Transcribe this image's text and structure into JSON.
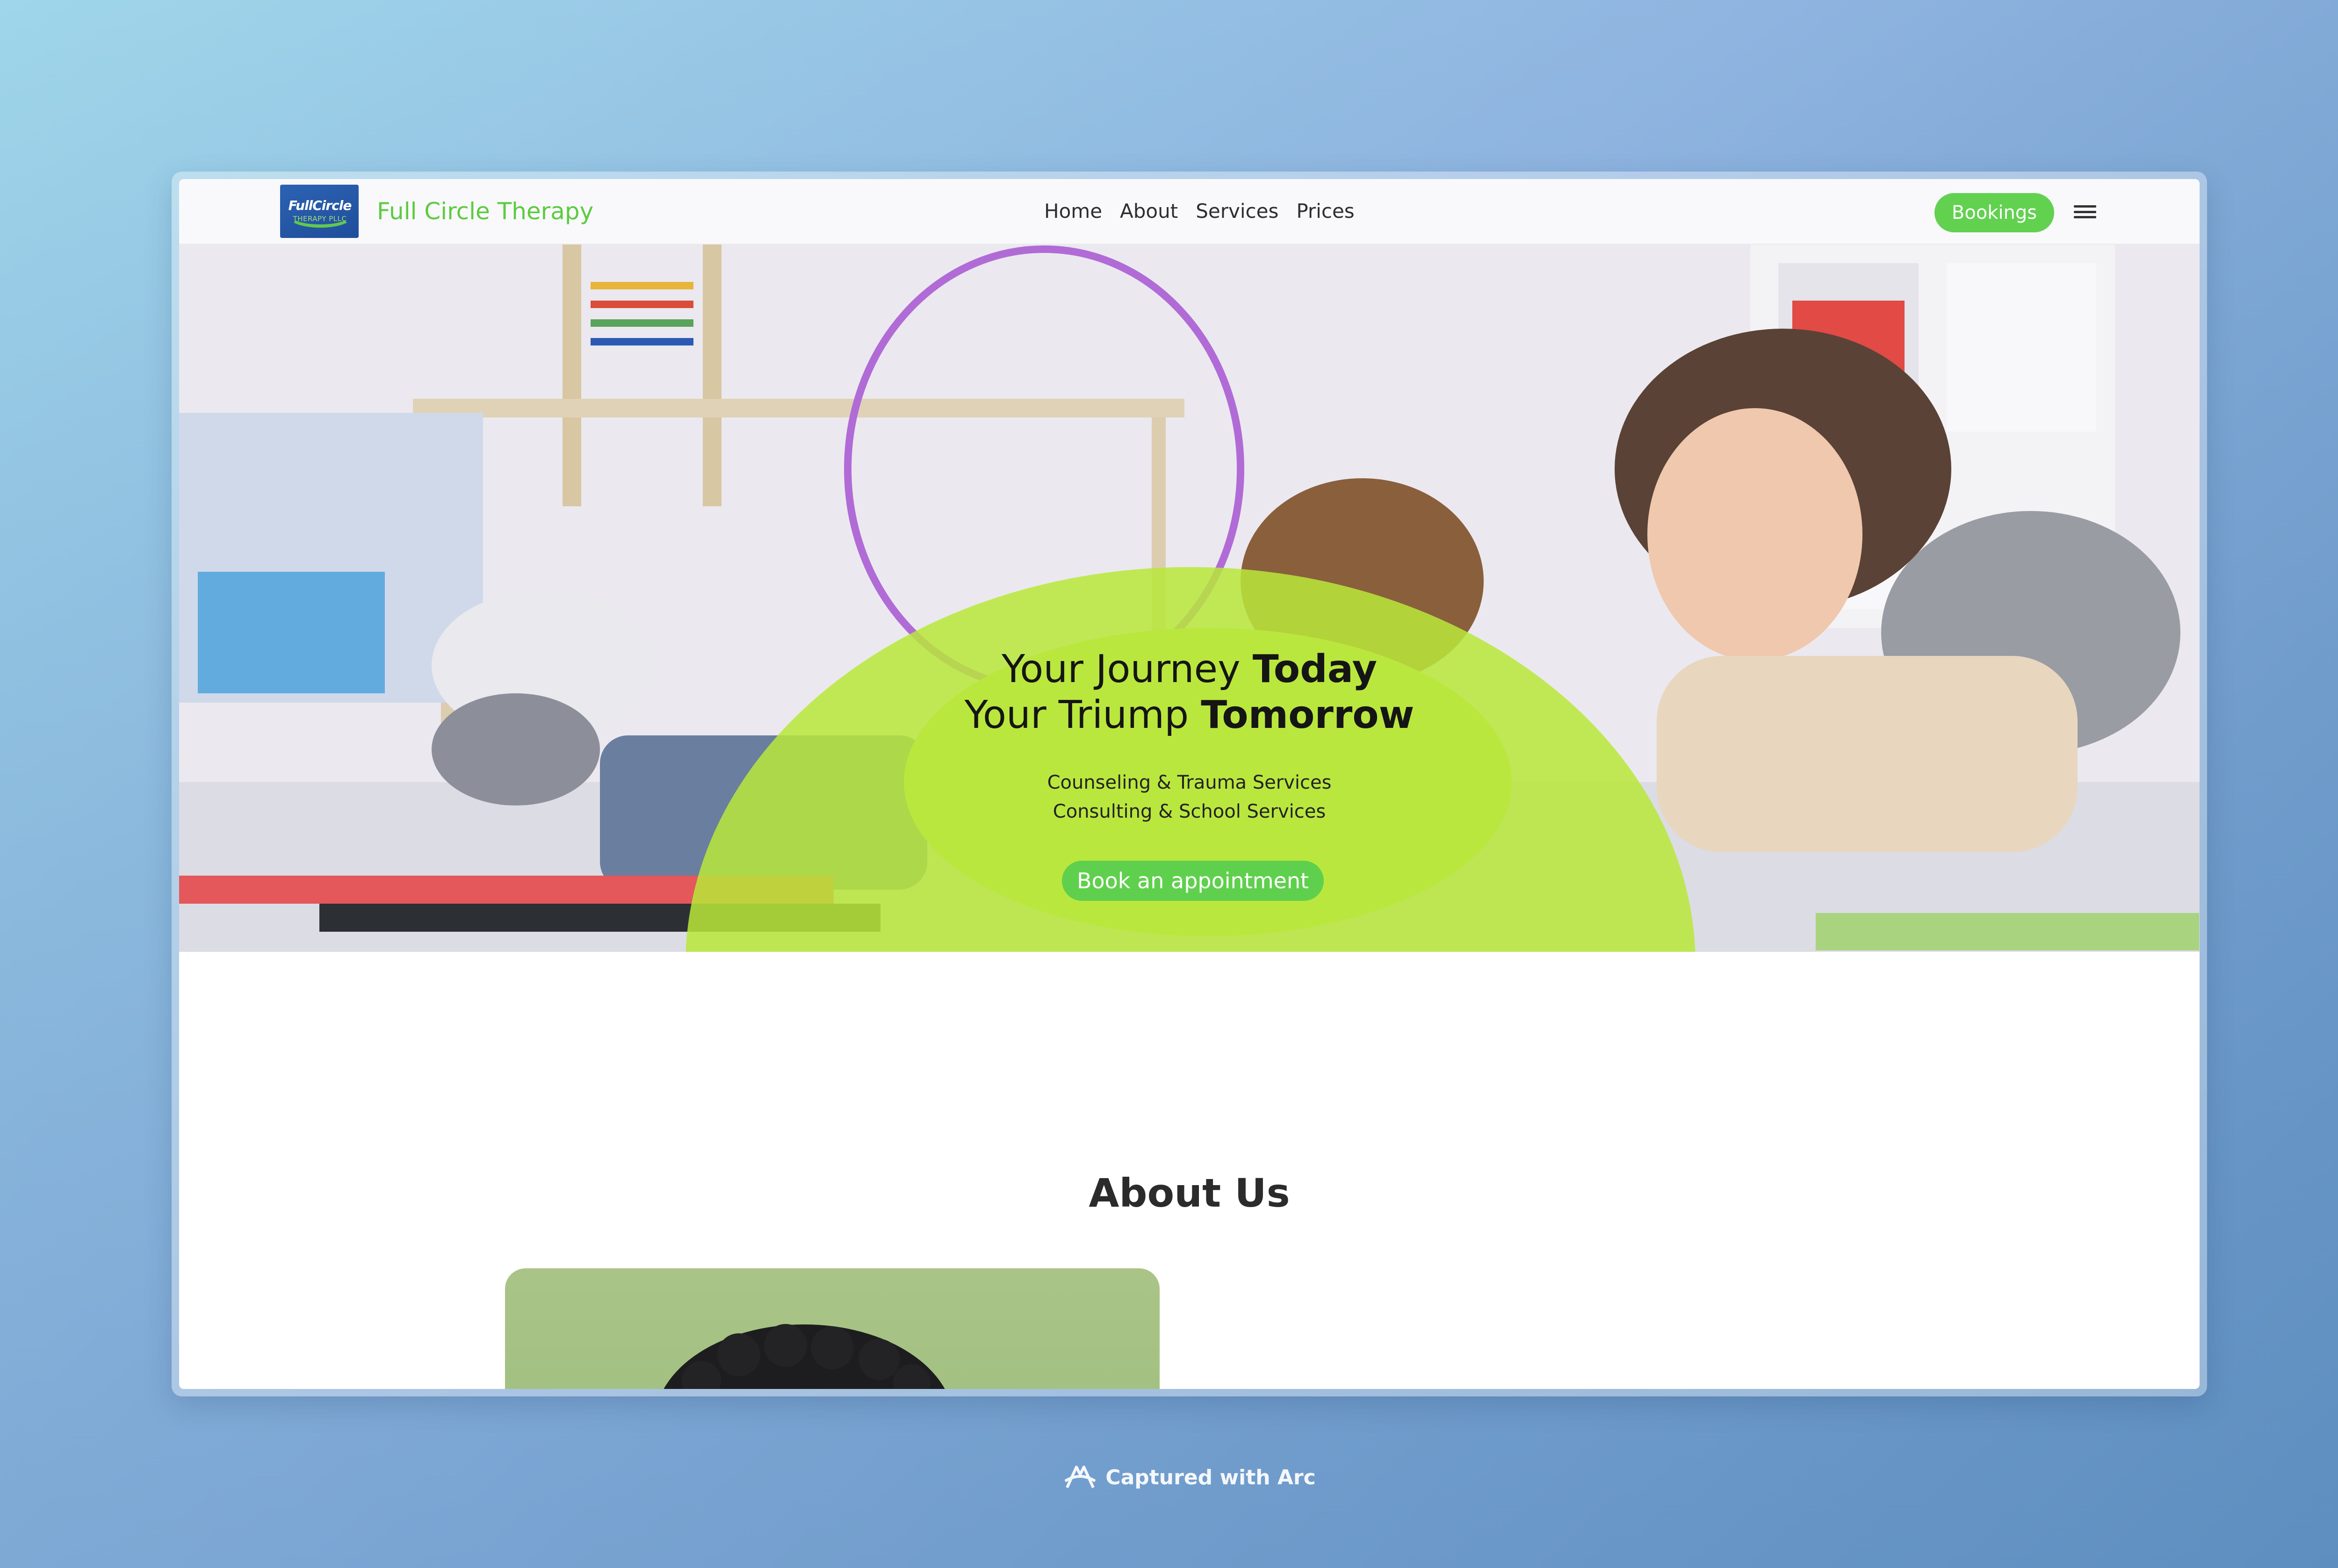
{
  "nav": {
    "logo_text_main": "FullCircle",
    "logo_text_sub": "THERAPY PLLC",
    "brand": "Full Circle Therapy",
    "menu": [
      "Home",
      "About",
      "Services",
      "Prices"
    ],
    "bookings_label": "Bookings"
  },
  "hero": {
    "title_line1_regular": "Your Journey ",
    "title_line1_bold": "Today",
    "title_line2_regular": "Your Triump ",
    "title_line2_bold": "Tomorrow",
    "sub_line1": "Counseling & Trauma Services",
    "sub_line2": "Consulting & School Services",
    "cta_label": "Book an appointment"
  },
  "about": {
    "title": "About Us"
  },
  "footer_caption": "Captured with Arc",
  "colors": {
    "accent_green": "#5fd04d",
    "brand_green": "#5ccb3e",
    "hero_overlay": "#b8e83a"
  },
  "icons": [
    "hamburger-menu-icon",
    "arc-logo-icon"
  ]
}
